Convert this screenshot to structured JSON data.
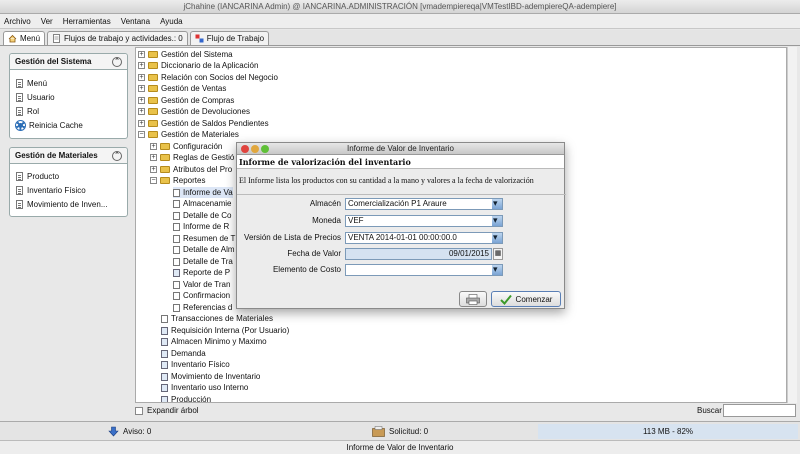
{
  "window": {
    "title": "jChahine (IANCARINA Admin) @ IANCARINA.ADMINISTRACIÓN [vmadempiereqa|VMTestIBD-adempiereQA-adempiere]"
  },
  "menubar": [
    "Archivo",
    "Ver",
    "Herramientas",
    "Ventana",
    "Ayuda"
  ],
  "tabs": [
    {
      "label": "Menú"
    },
    {
      "label": "Flujos de trabajo y actividades.: 0"
    },
    {
      "label": "Flujo de Trabajo"
    }
  ],
  "sidebar": {
    "system": {
      "title": "Gestión del Sistema",
      "items": [
        "Menú",
        "Usuario",
        "Rol",
        "Reinicia Cache"
      ]
    },
    "materials": {
      "title": "Gestión de Materiales",
      "items": [
        "Producto",
        "Inventario Físico",
        "Movimiento de Inven..."
      ]
    }
  },
  "tree": [
    "Gestión del Sistema",
    "Diccionario de la Aplicación",
    "Relación con Socios del Negocio",
    "Gestión de Ventas",
    "Gestión de Compras",
    "Gestión de Devoluciones",
    "Gestión de Saldos Pendientes",
    "Gestión de Materiales",
    "Configuración",
    "Reglas de Gestió",
    "Atributos del Pro",
    "Reportes",
    "Informe de Va",
    "Almacenamie",
    "Detalle de Co",
    "Informe de R",
    "Resumen de T",
    "Detalle de Alm",
    "Detalle de Tra",
    "Reporte de P",
    "Valor de Tran",
    "Confirmacion",
    "Referencias d",
    "Transacciones de Materiales",
    "Requisición Interna (Por Usuario)",
    "Almacen Minimo y Maximo",
    "Demanda",
    "Inventario Físico",
    "Movimiento de Inventario",
    "Inventario uso Interno",
    "Producción"
  ],
  "bottom": {
    "expand_label": "Expandir árbol",
    "search_label": "Buscar"
  },
  "status": {
    "aviso": "Aviso: 0",
    "solicitud": "Solicitud: 0",
    "memory": "113 MB - 82%"
  },
  "footer": "Informe de Valor de Inventario",
  "dialog": {
    "title": "Informe de Valor de Inventario",
    "heading": "Informe de valorización del inventario",
    "description": "El Informe lista los productos con su cantidad a la mano y valores a la fecha de valorización",
    "fields": {
      "almacen": {
        "label": "Almacén",
        "value": "Comercialización P1 Araure"
      },
      "moneda": {
        "label": "Moneda",
        "value": "VEF"
      },
      "lista": {
        "label": "Versión de Lista de Precios",
        "value": "VENTA 2014-01-01 00:00:00.0"
      },
      "fecha": {
        "label": "Fecha de Valor",
        "value": "09/01/2015"
      },
      "costo": {
        "label": "Elemento de Costo",
        "value": ""
      }
    },
    "start_label": "Comenzar"
  }
}
